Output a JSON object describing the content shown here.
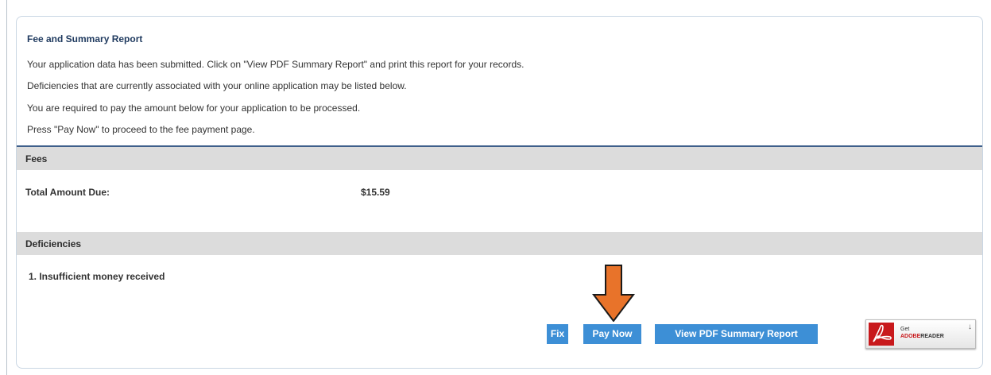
{
  "summary": {
    "title": "Fee and Summary Report",
    "lines": [
      "Your application data has been submitted. Click on \"View PDF Summary Report\" and print this report for your records.",
      "Deficiencies that are currently associated with your online application may be listed below.",
      "You are required to pay the amount below for your application to be processed.",
      "Press \"Pay Now\" to proceed to the fee payment page."
    ]
  },
  "fees": {
    "section_label": "Fees",
    "total_label": "Total Amount Due:",
    "total_value": "$15.59"
  },
  "deficiencies": {
    "section_label": "Deficiencies",
    "items": [
      "1. Insufficient money received"
    ]
  },
  "actions": {
    "fix_label": "Fix",
    "pay_now_label": "Pay Now",
    "view_pdf_label": "View PDF Summary Report"
  },
  "adobe_badge": {
    "get_text": "Get",
    "brand_text": "ADOBE",
    "product_text": "READER",
    "icon": "adobe-pdf-icon",
    "download_icon": "download-arrow-icon"
  },
  "annotation": {
    "icon": "down-arrow-icon",
    "color": "#e8732a"
  },
  "colors": {
    "button_blue": "#3d8fd6",
    "section_gray": "#dcdcdc",
    "rule_blue": "#3e5f8a",
    "title_navy": "#1f3a5f"
  }
}
